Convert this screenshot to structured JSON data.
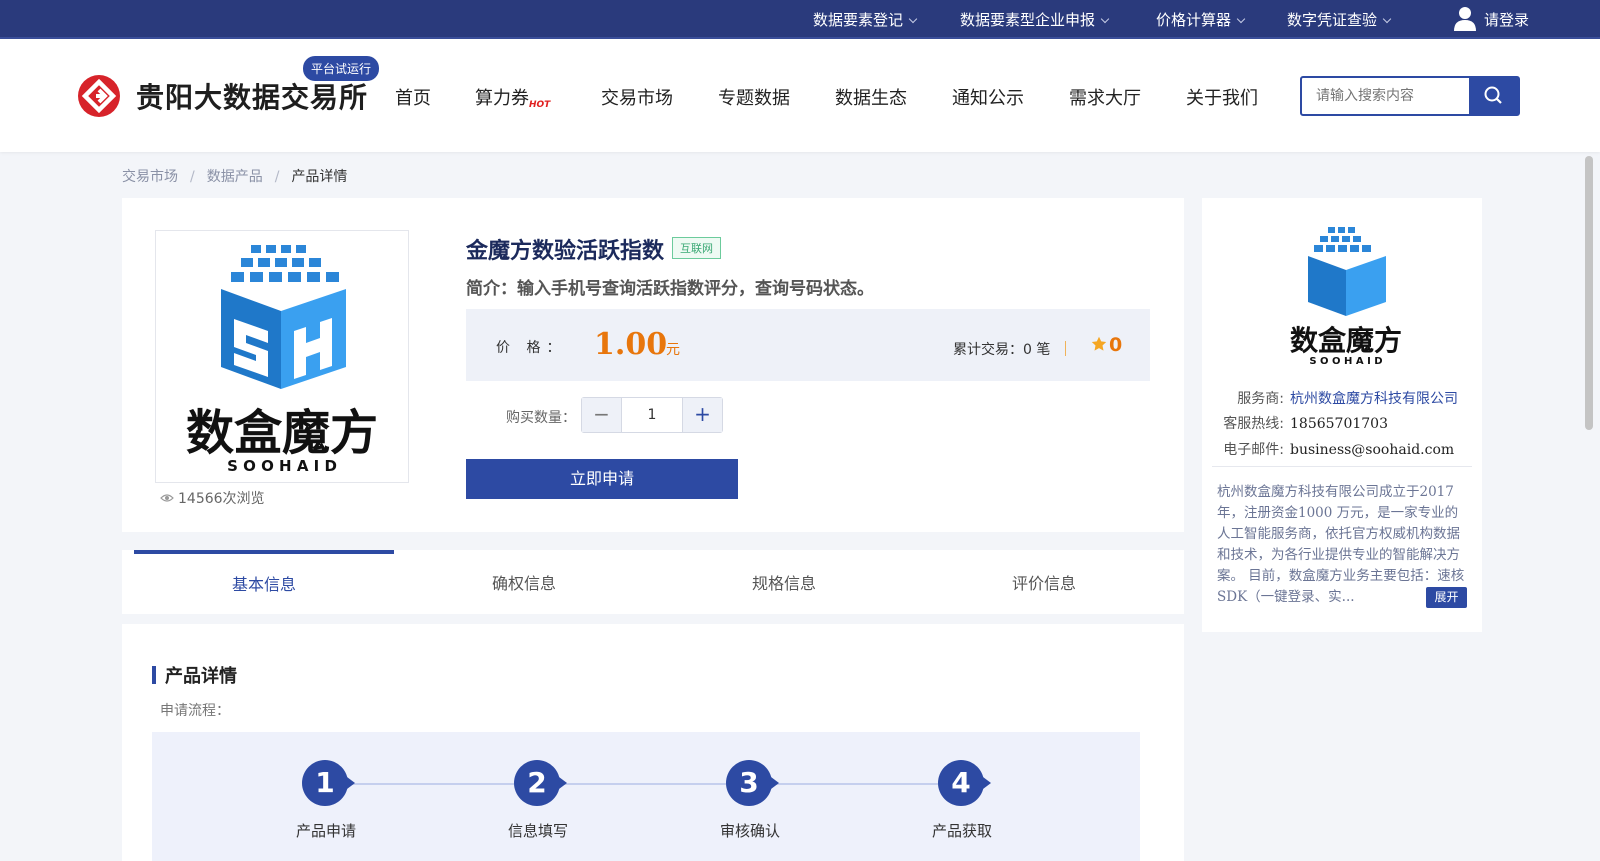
{
  "colors": {
    "primary": "#2d4aa3",
    "topbar": "#2a3a7c",
    "price": "#e8760c",
    "tag": "#3aa874"
  },
  "topbar": {
    "items": [
      "数据要素登记",
      "数据要素型企业申报",
      "价格计算器",
      "数字凭证查验"
    ],
    "login": "请登录",
    "icons": [
      "chevron-down-icon",
      "user-icon"
    ]
  },
  "header": {
    "brand": "贵阳大数据交易所",
    "badge": "平台试运行",
    "nav": [
      "首页",
      "算力券",
      "交易市场",
      "专题数据",
      "数据生态",
      "通知公示",
      "需求大厅",
      "关于我们"
    ],
    "hot_label": "HOT",
    "search_placeholder": "请输入搜索内容"
  },
  "breadcrumb": {
    "items": [
      "交易市场",
      "数据产品"
    ],
    "current": "产品详情",
    "sep": "/"
  },
  "product": {
    "views": "14566次浏览",
    "title": "金魔方数验活跃指数",
    "tag": "互联网",
    "intro": "简介：输入手机号查询活跃指数评分，查询号码状态。",
    "price_label": "价 格：",
    "price": "1.00",
    "unit": "元",
    "trades": "累计交易：0 笔",
    "rating": "0",
    "qty_label": "购买数量：",
    "qty": "1",
    "minus": "−",
    "plus": "+",
    "apply": "立即申请",
    "logo_text": "数盒魔方",
    "logo_sub": "S O O H A I D"
  },
  "tabs": [
    "基本信息",
    "确权信息",
    "规格信息",
    "评价信息"
  ],
  "active_tab": 0,
  "detail": {
    "title": "产品详情",
    "flow_label": "申请流程：",
    "steps": [
      {
        "n": "1",
        "label": "产品申请"
      },
      {
        "n": "2",
        "label": "信息填写"
      },
      {
        "n": "3",
        "label": "审核确认"
      },
      {
        "n": "4",
        "label": "产品获取"
      }
    ]
  },
  "provider": {
    "rows": [
      {
        "k": "服务商:",
        "v": "杭州数盒魔方科技有限公司"
      },
      {
        "k": "客服热线:",
        "v": "18565701703"
      },
      {
        "k": "电子邮件:",
        "v": "business@soohaid.com"
      }
    ],
    "desc": "杭州数盒魔方科技有限公司成立于2017年，注册资金1000 万元，是一家专业的人工智能服务商，依托官方权威机构数据和技术，为各行业提供专业的智能解决方案。 目前，数盒魔方业务主要包括：速核 SDK（一键登录、实...",
    "expand": "展开"
  }
}
